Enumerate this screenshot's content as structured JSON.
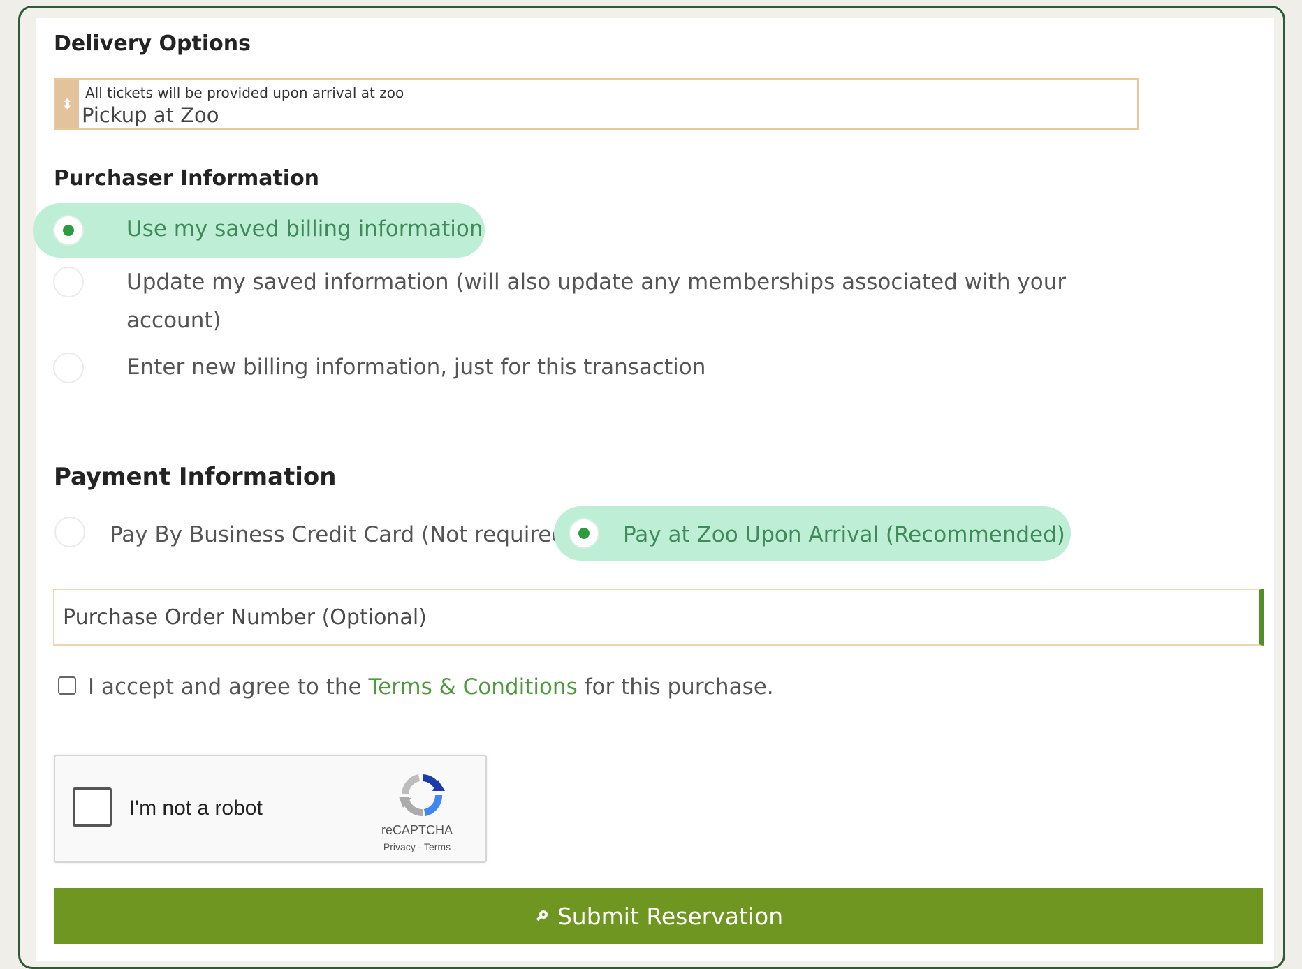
{
  "delivery": {
    "heading": "Delivery Options",
    "hint": "All tickets will be provided upon arrival at zoo",
    "selected": "Pickup at Zoo"
  },
  "purchaser": {
    "heading": "Purchaser Information",
    "options": [
      {
        "label": "Use my saved billing information",
        "checked": true
      },
      {
        "label_line1": "Update my saved information (will also update any memberships associated with your",
        "label_line2": "account)",
        "checked": false
      },
      {
        "label": "Enter new billing information, just for this transaction",
        "checked": false
      }
    ]
  },
  "payment": {
    "heading": "Payment Information",
    "options": [
      {
        "label": "Pay By Business Credit Card (Not required)",
        "checked": false
      },
      {
        "label": "Pay at Zoo Upon Arrival (Recommended)",
        "checked": true
      }
    ],
    "po_placeholder": "Purchase Order Number (Optional)"
  },
  "terms": {
    "prefix": "I accept and agree to the",
    "link": "Terms & Conditions",
    "suffix": "for this purchase.",
    "checked": false
  },
  "recaptcha": {
    "label": "I'm not a robot",
    "brand": "reCAPTCHA",
    "links": "Privacy - Terms"
  },
  "submit": {
    "label": "Submit Reservation",
    "icon": "key-icon"
  },
  "colors": {
    "accent_green": "#6e9620",
    "selection_highlight": "#bfeed7",
    "link_green": "#4c9a3c",
    "frame_green": "#2f5a36"
  }
}
